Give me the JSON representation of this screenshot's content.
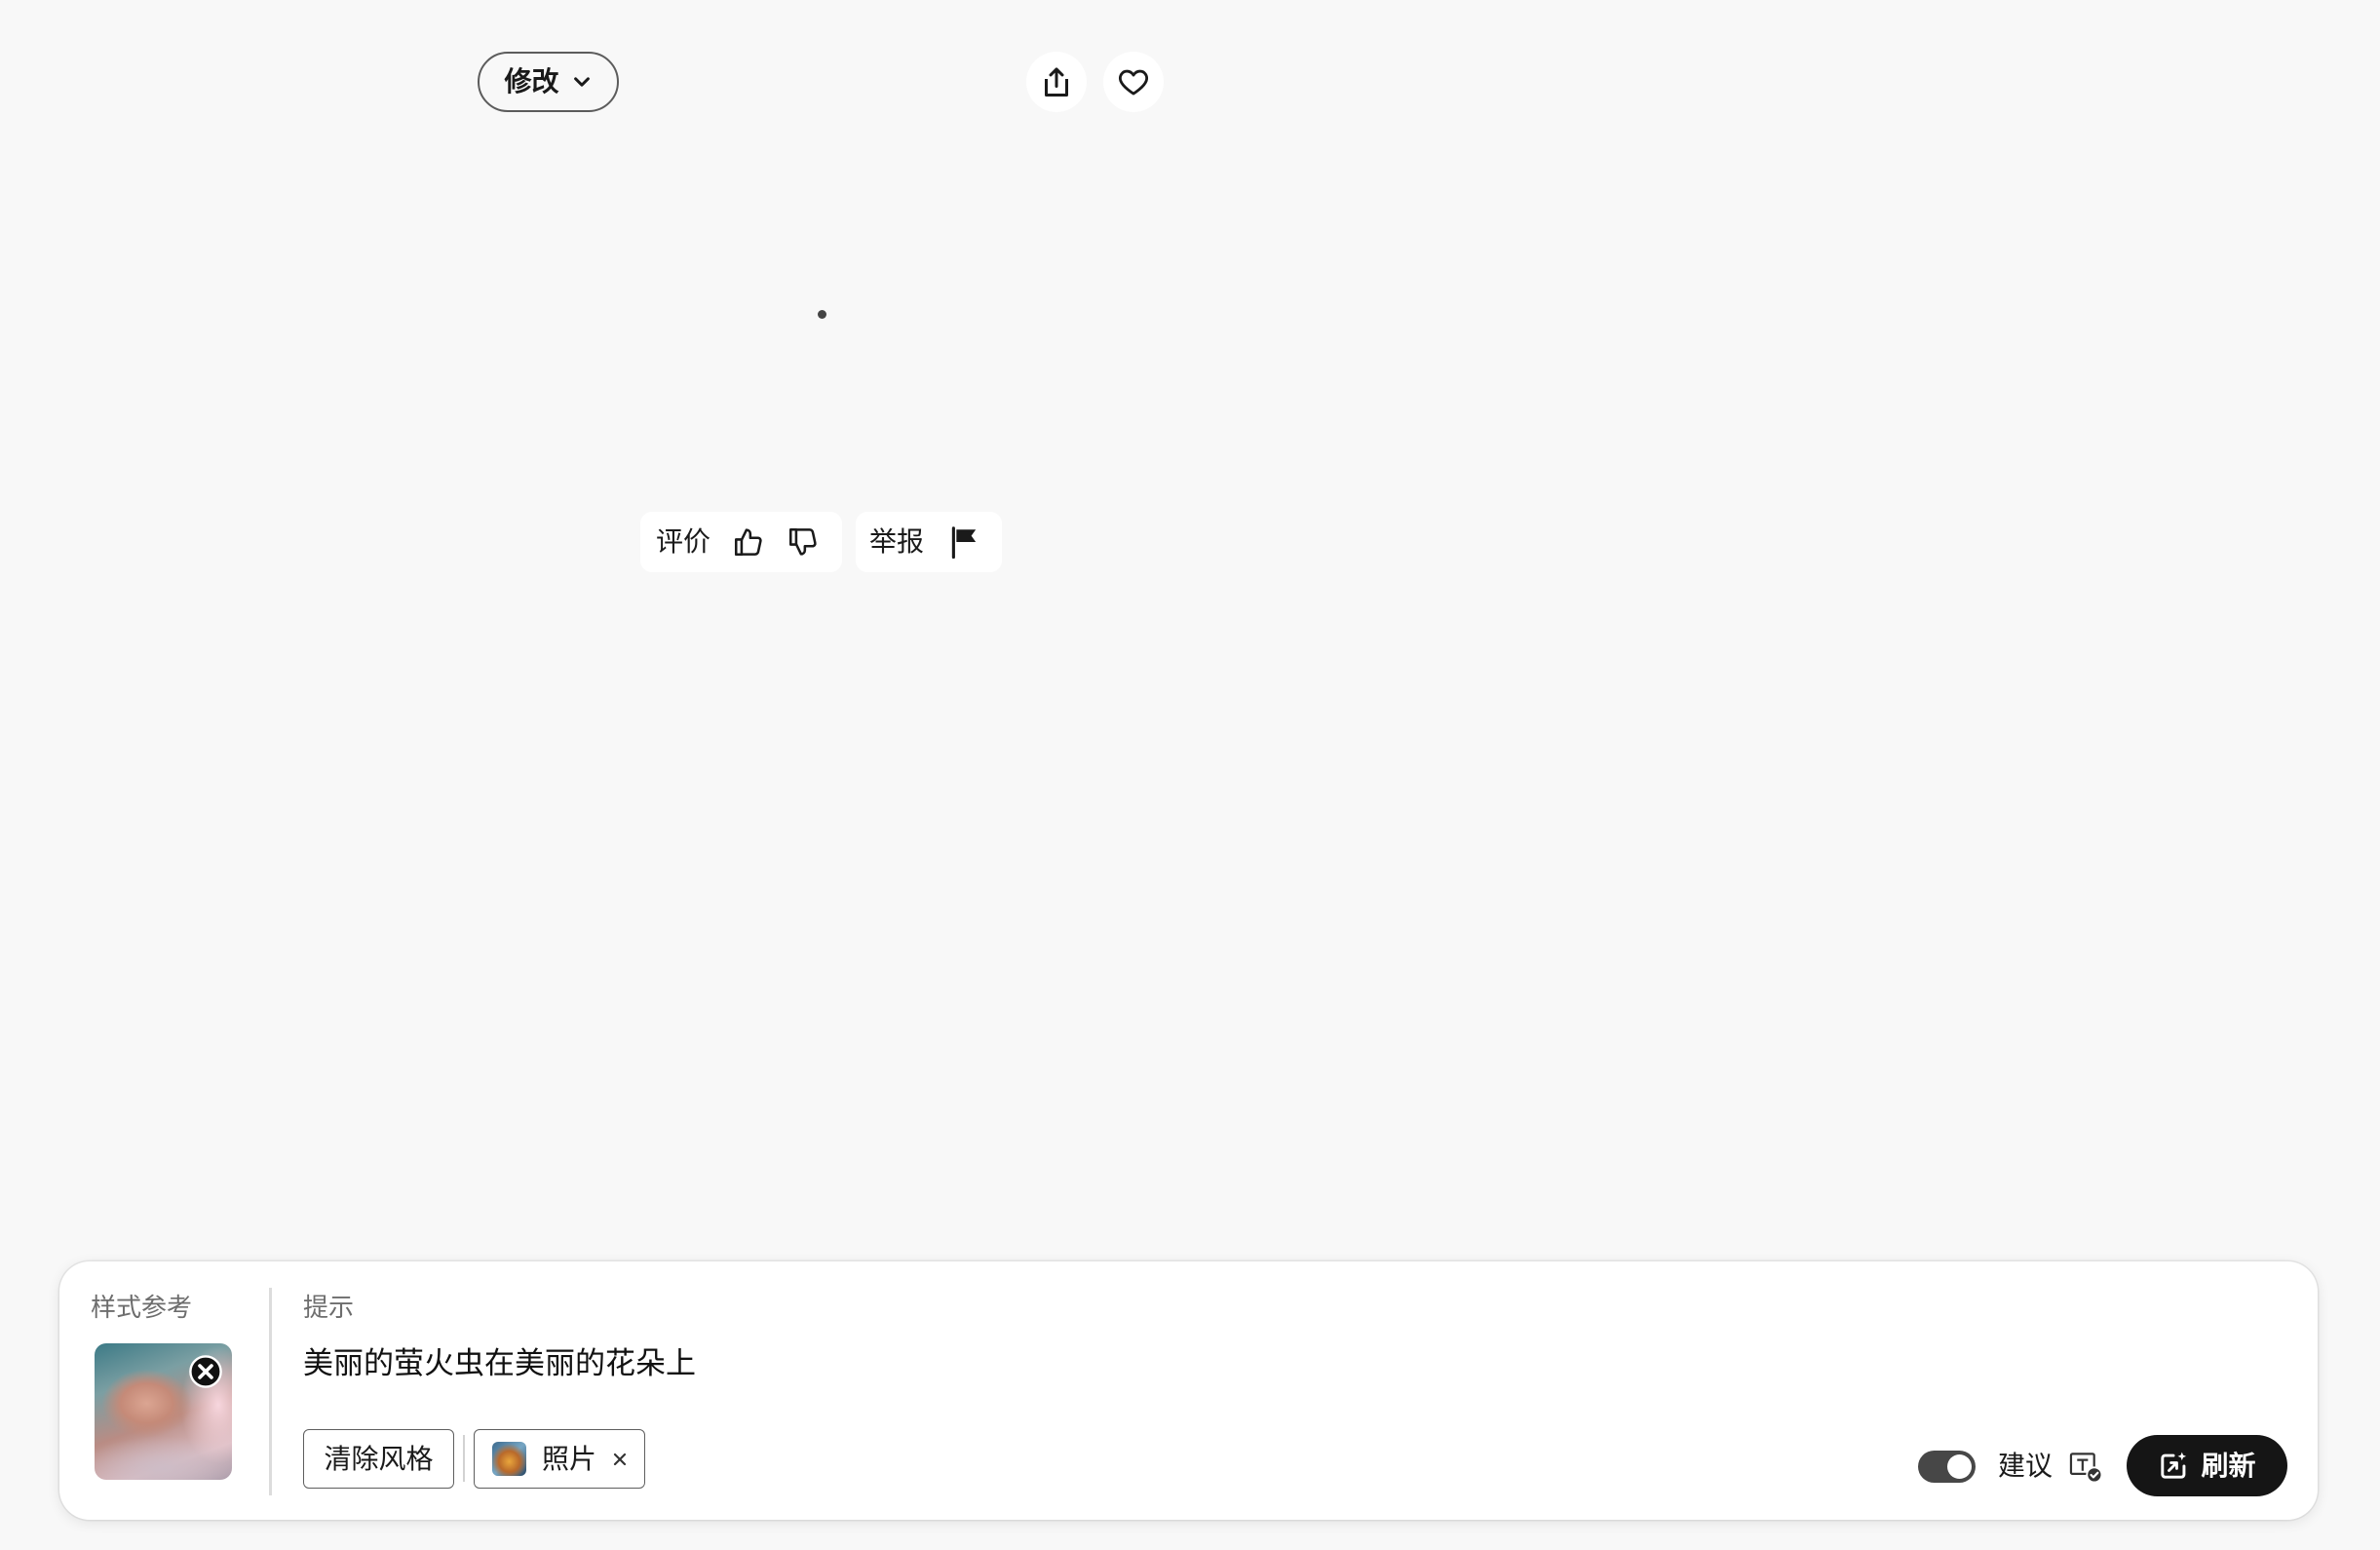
{
  "header": {
    "modify_label": "修改"
  },
  "feedback": {
    "rate_label": "评价",
    "report_label": "举报"
  },
  "composer": {
    "style_reference_label": "样式参考",
    "prompt_label": "提示",
    "prompt_text": "美丽的萤火虫在美丽的花朵上",
    "clear_style_label": "清除风格",
    "style_chip_label": "照片",
    "suggestions_label": "建议",
    "suggestions_enabled": true,
    "refresh_label": "刷新"
  },
  "icons": {
    "modify_dropdown": "chevron-down-icon",
    "share": "share-icon",
    "favorite": "heart-icon",
    "thumbs_up": "thumbs-up-icon",
    "thumbs_down": "thumbs-down-icon",
    "report": "flag-icon",
    "remove_reference": "close-icon",
    "remove_style": "close-icon",
    "suggestion_settings": "text-check-icon",
    "refresh": "generate-icon"
  },
  "colors": {
    "page_background": "#f8f8f8",
    "panel_background": "#ffffff",
    "primary_button": "#151515",
    "toggle_on": "#474747",
    "text_primary": "#1a1a1a",
    "text_secondary": "#6d6d6d"
  }
}
